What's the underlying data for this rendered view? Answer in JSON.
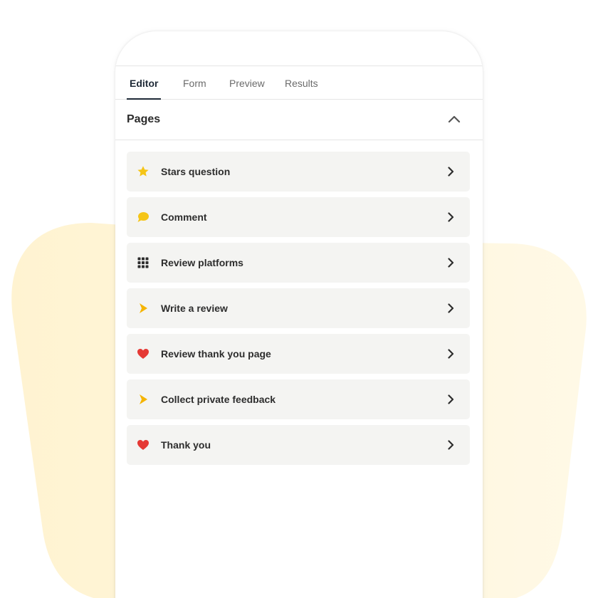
{
  "tabs": {
    "editor": "Editor",
    "form": "Form",
    "preview": "Preview",
    "results": "Results",
    "active": "Editor"
  },
  "pages_section": {
    "title": "Pages",
    "expanded": true
  },
  "pages": [
    {
      "label": "Stars question",
      "icon": "star-icon",
      "icon_color": "#f5c518"
    },
    {
      "label": "Comment",
      "icon": "speech-bubble-icon",
      "icon_color": "#f5c518"
    },
    {
      "label": "Review platforms",
      "icon": "grid-icon",
      "icon_color": "#2d2d2d"
    },
    {
      "label": "Write a review",
      "icon": "play-arrow-icon",
      "icon_color": "#f5b400"
    },
    {
      "label": "Review thank you page",
      "icon": "heart-icon",
      "icon_color": "#e53935"
    },
    {
      "label": "Collect private feedback",
      "icon": "play-arrow-icon",
      "icon_color": "#f5b400"
    },
    {
      "label": "Thank you",
      "icon": "heart-icon",
      "icon_color": "#e53935"
    }
  ],
  "colors": {
    "background_blob": "#fff5d6",
    "item_background": "#f4f4f2",
    "active_tab": "#1f2a37"
  }
}
